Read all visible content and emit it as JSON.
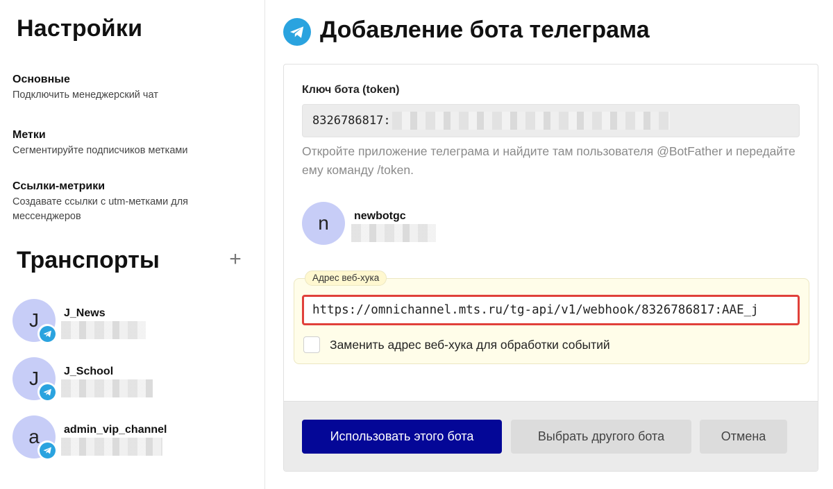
{
  "sidebar": {
    "title": "Настройки",
    "menu": [
      {
        "title": "Основные",
        "subtitle": "Подключить менеджерский чат"
      },
      {
        "title": "Метки",
        "subtitle": "Сегментируйте подписчиков метками"
      },
      {
        "title": "Ссылки-метрики",
        "subtitle": "Создавате ссылки с utm-метками для мессенджеров"
      }
    ],
    "transports_title": "Транспорты",
    "add_icon": "+",
    "transports": [
      {
        "initial": "J",
        "name": "J_News",
        "icon": "telegram-icon"
      },
      {
        "initial": "J",
        "name": "J_School",
        "icon": "telegram-icon"
      },
      {
        "initial": "a",
        "name": "admin_vip_channel",
        "icon": "telegram-icon"
      }
    ]
  },
  "main": {
    "title": "Добавление бота телеграма",
    "title_icon": "telegram-icon",
    "token_label": "Ключ бота (token)",
    "token_value": "8326786817:",
    "hint": "Откройте приложение телеграма и найдите там пользователя @BotFather и передайте ему команду /token.",
    "bot": {
      "initial": "n",
      "name": "newbotgc"
    },
    "webhook_label": "Адрес веб-хука",
    "webhook_value": "https://omnichannel.mts.ru/tg-api/v1/webhook/8326786817:AAE_j",
    "checkbox_label": "Заменить адрес веб-хука для обработки событий",
    "buttons": {
      "primary": "Использовать этого бота",
      "secondary": "Выбрать другого бота",
      "cancel": "Отмена"
    }
  },
  "colors": {
    "primary_button": "#040797",
    "telegram": "#2aa3df",
    "avatar": "#c7cdf7",
    "highlight_border": "#e0403a",
    "webhook_bg": "#fffde9"
  }
}
